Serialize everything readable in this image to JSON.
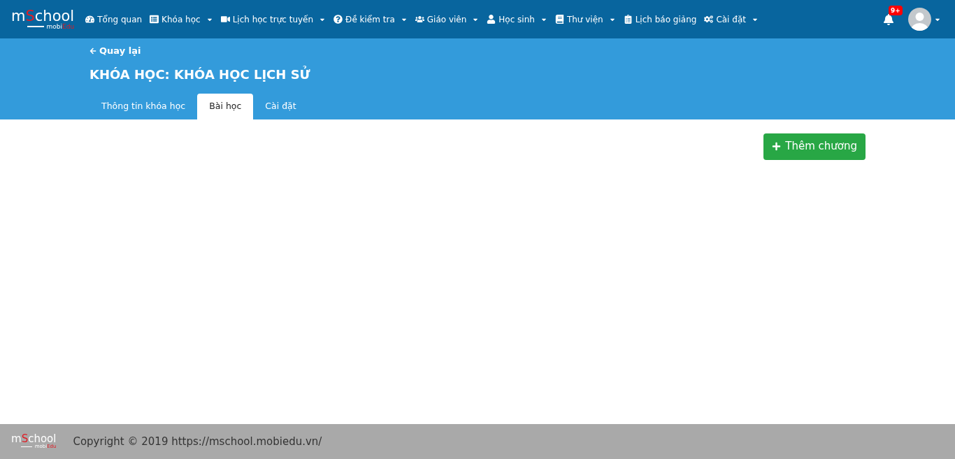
{
  "logo": {
    "prefix": "m",
    "accent": "S",
    "suffix": "chool",
    "sub": "mobi",
    "sub_accent": "Edu"
  },
  "nav": [
    {
      "label": "Tổng quan",
      "dropdown": false
    },
    {
      "label": "Khóa học",
      "dropdown": true
    },
    {
      "label": "Lịch học trực tuyến",
      "dropdown": true
    },
    {
      "label": "Đề kiểm tra",
      "dropdown": true
    },
    {
      "label": "Giáo viên",
      "dropdown": true
    },
    {
      "label": "Học sinh",
      "dropdown": true
    },
    {
      "label": "Thư viện",
      "dropdown": true
    },
    {
      "label": "Lịch báo giảng",
      "dropdown": false
    },
    {
      "label": "Cài đặt",
      "dropdown": true
    }
  ],
  "notifications": {
    "badge": "9+"
  },
  "header": {
    "back": "Quay lại",
    "title": "KHÓA HỌC: KHÓA HỌC LỊCH SỬ"
  },
  "tabs": [
    {
      "label": "Thông tin khóa học",
      "selected": false
    },
    {
      "label": "Bài học",
      "selected": true
    },
    {
      "label": "Cài đặt",
      "selected": false
    }
  ],
  "add_button": "Thêm chương",
  "footer": {
    "logo": {
      "prefix": "m",
      "accent": "S",
      "suffix": "chool",
      "sub": "mobi",
      "sub_accent": "Edu"
    },
    "copyright": "Copyright © 2019 https://mschool.mobiedu.vn/"
  }
}
